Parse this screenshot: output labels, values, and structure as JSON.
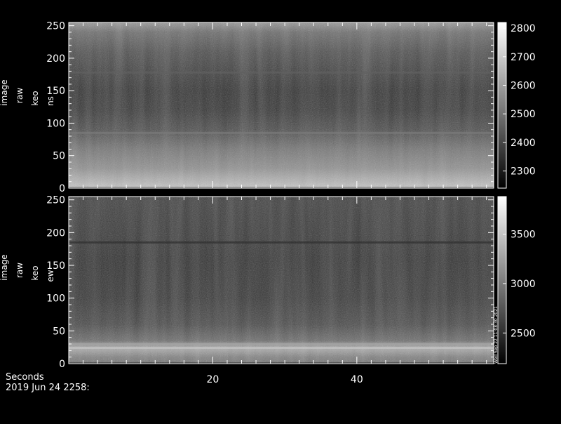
{
  "footer": {
    "xlabel": "Seconds",
    "date": "2019 Jun 24 2258:"
  },
  "chart_data": [
    {
      "type": "heatmap",
      "ylabel_lines": [
        "image",
        "raw",
        "keo",
        "ns"
      ],
      "xlim": [
        0,
        59
      ],
      "ylim": [
        0,
        255
      ],
      "x_ticks": [
        20,
        40
      ],
      "x_tick_labels_shown": false,
      "y_ticks": [
        0,
        50,
        100,
        150,
        200,
        250
      ],
      "colorbar": {
        "min": 2240,
        "max": 2820,
        "ticks": [
          2300,
          2400,
          2500,
          2600,
          2700,
          2800
        ]
      },
      "colormap": "grayscale",
      "profile_rows": [
        0,
        30,
        60,
        90,
        120,
        150,
        180,
        210,
        240,
        255
      ],
      "profile_values": [
        2700,
        2560,
        2490,
        2390,
        2340,
        2330,
        2360,
        2400,
        2470,
        2580
      ],
      "features": [
        {
          "row": 85,
          "value": 2520
        },
        {
          "row": 178,
          "value": 2460
        },
        {
          "row": 0,
          "value": 2270
        }
      ]
    },
    {
      "type": "heatmap",
      "ylabel_lines": [
        "image",
        "raw",
        "keo",
        "ew"
      ],
      "xlim": [
        0,
        59
      ],
      "ylim": [
        0,
        255
      ],
      "x_ticks": [
        20,
        40
      ],
      "x_tick_labels": [
        "20",
        "40"
      ],
      "y_ticks": [
        0,
        50,
        100,
        150,
        200,
        250
      ],
      "colorbar": {
        "min": 2190,
        "max": 3880,
        "ticks": [
          2500,
          3000,
          3500
        ],
        "side_label": "Wed Sep 22 11:08:30 2021"
      },
      "colormap": "grayscale",
      "profile_rows": [
        0,
        10,
        20,
        25,
        35,
        60,
        100,
        160,
        200,
        255
      ],
      "profile_values": [
        2900,
        3000,
        3250,
        3300,
        2850,
        2600,
        2480,
        2440,
        2480,
        2520
      ],
      "features": [
        {
          "row": 24,
          "value": 3500
        },
        {
          "row": 30,
          "value": 3300
        },
        {
          "row": 185,
          "value": 2500
        },
        {
          "row": 0,
          "value": 2250
        }
      ]
    }
  ]
}
